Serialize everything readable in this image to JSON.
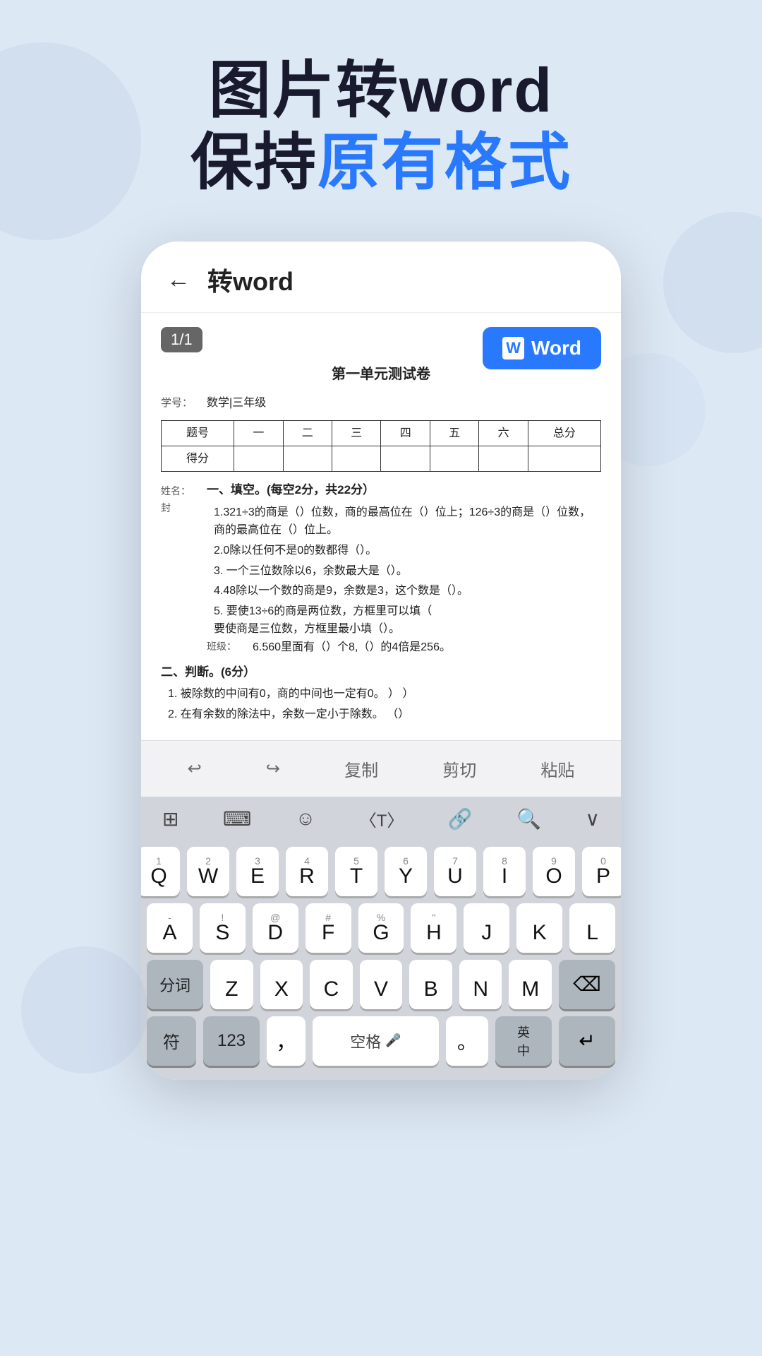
{
  "hero": {
    "line1": "图片转word",
    "line2_part1": "保持",
    "line2_part2": "原有格式",
    "accent_color": "#2979ff"
  },
  "app": {
    "header": {
      "back_label": "←",
      "title": "转word"
    },
    "page_badge": "1/1",
    "word_button": "Word",
    "document": {
      "title": "第一单元测试卷",
      "subject_label": "学号：",
      "subject_value": "数学|三年级",
      "table_headers": [
        "题号",
        "一",
        "二",
        "三",
        "四",
        "五",
        "六",
        "总分"
      ],
      "table_row2": [
        "得分",
        "",
        "",
        "",
        "",
        "",
        "",
        ""
      ],
      "section1_title": "一、填空。(每空2分，共22分）",
      "items": [
        "1.321÷3的商是（）位数，商的最高位在（）位上；126÷3的商是（）位数，商的最高位在（）位上。",
        "2.0除以任何不是0的数都得（）。",
        "3．一个三位数除以6，余数最大是（）。",
        "4.48除以一个数的商是9，余数是3，这个数是（）。",
        "5．要使13÷6的商是两位数，方框里可以填（要使商是三位数，方框里最小填（）。",
        "6.560里面有（）个8,（）的4倍是256。"
      ],
      "name_label": "姓名：封",
      "class_label": "班级：",
      "section2_title": "二、判断。(6分）",
      "judge_items": [
        "1. 被除数的中间有0，商的中间也一定有0。   ）              ）",
        "2. 在有余数的除法中，余数一定小于除数。   （）"
      ]
    },
    "toolbar": {
      "undo": "↩",
      "redo": "↪",
      "copy": "复制",
      "cut": "剪切",
      "paste": "粘贴"
    },
    "kb_toolbar": {
      "grid_icon": "⊞",
      "keyboard_icon": "⌨",
      "emoji_icon": "☺",
      "code_icon": "⟨⟩",
      "link_icon": "⛓",
      "search_icon": "🔍",
      "collapse_icon": "∨"
    },
    "keyboard": {
      "row1": [
        {
          "sub": "1",
          "main": "Q"
        },
        {
          "sub": "2",
          "main": "W"
        },
        {
          "sub": "3",
          "main": "E"
        },
        {
          "sub": "4",
          "main": "R"
        },
        {
          "sub": "5",
          "main": "T"
        },
        {
          "sub": "6",
          "main": "Y"
        },
        {
          "sub": "7",
          "main": "U"
        },
        {
          "sub": "8",
          "main": "I"
        },
        {
          "sub": "9",
          "main": "O"
        },
        {
          "sub": "0",
          "main": "P"
        }
      ],
      "row2": [
        {
          "sub": "-",
          "main": "A"
        },
        {
          "sub": "!",
          "main": "S"
        },
        {
          "sub": "@",
          "main": "D"
        },
        {
          "sub": "#",
          "main": "F"
        },
        {
          "sub": "%",
          "main": "G"
        },
        {
          "sub": "\"",
          "main": "H"
        },
        {
          "sub": "",
          "main": "J"
        },
        {
          "sub": "",
          "main": "K"
        },
        {
          "sub": "",
          "main": "L"
        }
      ],
      "row3_left": "分词",
      "row3": [
        {
          "sub": "",
          "main": "Z"
        },
        {
          "sub": "",
          "main": "X"
        },
        {
          "sub": "",
          "main": "C"
        },
        {
          "sub": "",
          "main": "V"
        },
        {
          "sub": "",
          "main": "B"
        },
        {
          "sub": "",
          "main": "N"
        },
        {
          "sub": "",
          "main": "M"
        }
      ],
      "row3_delete": "⌫",
      "row4_fu": "符",
      "row4_123": "123",
      "row4_comma": "，",
      "row4_space": "空格",
      "row4_period": "。",
      "row4_lang_top": "英",
      "row4_lang_bot": "中",
      "row4_return": "↵"
    }
  }
}
